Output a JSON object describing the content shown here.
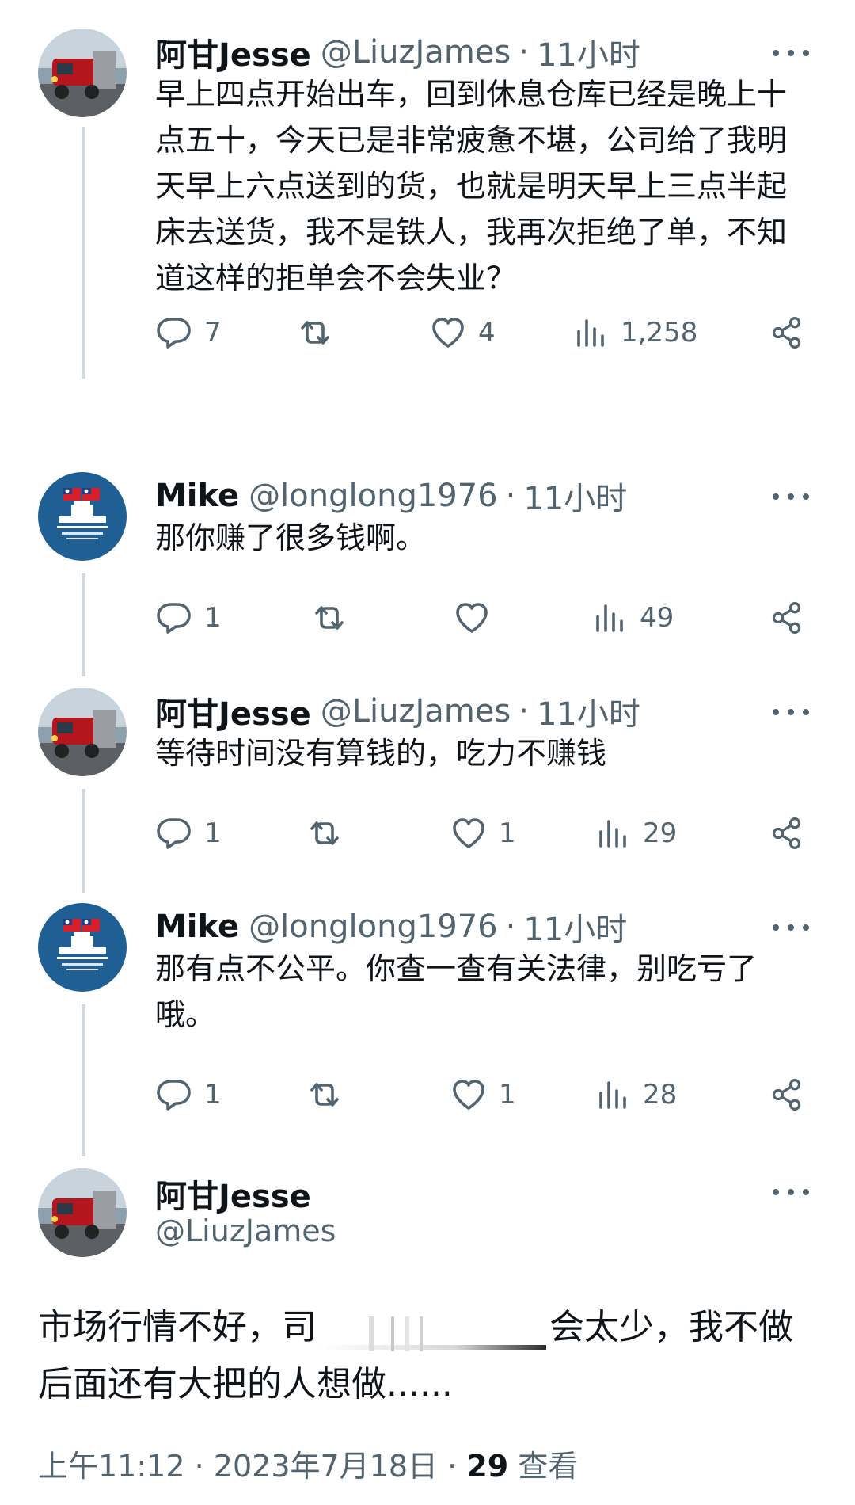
{
  "replies": [
    {
      "name": "阿甘Jesse",
      "handle": "@LiuzJames",
      "separator": "·",
      "time": "11小时",
      "avatar": "truck-avatar",
      "text": "早上四点开始出车，回到休息仓库已经是晚上十点五十，今天已是非常疲惫不堪，公司给了我明天早上六点送到的货，也就是明天早上三点半起床去送货，我不是铁人，我再次拒绝了单，不知道这样的拒单会不会失业？",
      "replies": "7",
      "retweets": "",
      "likes": "4",
      "views": "1,258"
    },
    {
      "name": "Mike",
      "handle": "@longlong1976",
      "separator": "·",
      "time": "11小时",
      "avatar": "emblem-avatar",
      "text": "那你赚了很多钱啊。",
      "replies": "1",
      "retweets": "",
      "likes": "",
      "views": "49"
    },
    {
      "name": "阿甘Jesse",
      "handle": "@LiuzJames",
      "separator": "·",
      "time": "11小时",
      "avatar": "truck-avatar",
      "text": "等待时间没有算钱的，吃力不赚钱",
      "replies": "1",
      "retweets": "",
      "likes": "1",
      "views": "29"
    },
    {
      "name": "Mike",
      "handle": "@longlong1976",
      "separator": "·",
      "time": "11小时",
      "avatar": "emblem-avatar",
      "text": "那有点不公平。你查一查有关法律，别吃亏了哦。",
      "replies": "1",
      "retweets": "",
      "likes": "1",
      "views": "28"
    }
  ],
  "main_tweet": {
    "name": "阿甘Jesse",
    "handle": "@LiuzJames",
    "text_before": "市场行情不好，司",
    "text_after": "会太少，我不做后面还有大把的人想做......",
    "time": "上午11:12",
    "separator": "·",
    "date": "2023年7月18日",
    "separator2": "·",
    "views": "29",
    "views_label": "查看"
  },
  "icons": {
    "reply": "reply-icon",
    "retweet": "retweet-icon",
    "like": "heart-icon",
    "views": "views-icon",
    "share": "share-icon",
    "more": "more-icon"
  },
  "colors": {
    "text": "#0f1419",
    "secondary": "#536471",
    "thread_line": "#cfd9de"
  }
}
